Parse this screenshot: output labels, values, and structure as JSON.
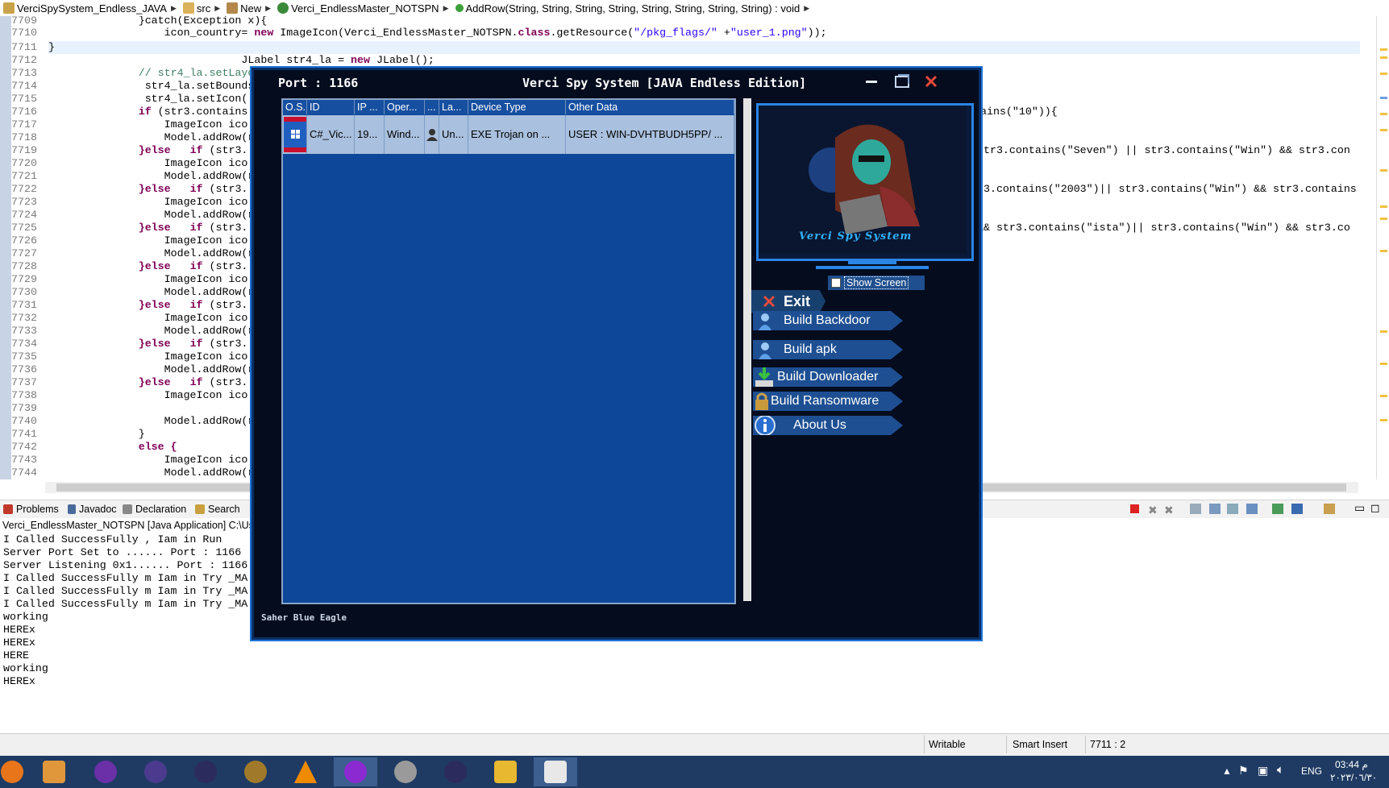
{
  "breadcrumb": [
    "VerciSpySystem_Endless_JAVA",
    "src",
    "New",
    "Verci_EndlessMaster_NOTSPN",
    "AddRow(String, String, String, String, String, String, String, String) : void"
  ],
  "code": {
    "line_numbers": [
      "7709",
      "7710",
      "7711",
      "7712",
      "7713",
      "7714",
      "7715",
      "7716",
      "7717",
      "7718",
      "7719",
      "7720",
      "7721",
      "7722",
      "7723",
      "7724",
      "7725",
      "7726",
      "7727",
      "7728",
      "7729",
      "7730",
      "7731",
      "7732",
      "7733",
      "7734",
      "7735",
      "7736",
      "7737",
      "7738",
      "7739",
      "7740",
      "7741",
      "7742",
      "7743",
      "7744"
    ],
    "line_7709": "}catch(Exception x){",
    "line_7710_pre": "icon_country= ",
    "line_7710_kw": "new",
    "line_7710_mid": " ImageIcon(Verci_EndlessMaster_NOTSPN.",
    "line_7710_kw2": "class",
    "line_7710_call": ".getResource(",
    "line_7710_s1": "\"/pkg_flags/\"",
    "line_7710_plus": " +",
    "line_7710_s2": "\"user_1.png\"",
    "line_7710_end": "));",
    "line_7711": "}",
    "line_7712_pre": "JLabel str4_la = ",
    "line_7712_kw": "new",
    "line_7712_post": " JLabel();",
    "line_7713": "// str4_la.setLayout",
    "line_7714": "str4_la.setBounds",
    "line_7715": "str4_la.setIcon(",
    "if": "if",
    "else": "}else",
    "str3": " (str3.contains",
    "str3s": " (str3.",
    "imageicon": "ImageIcon ico",
    "addrow": "Model.addRow(",
    "addrow_cut": "Model.addRow(r",
    "close_brace": "}",
    "else_open": "else {",
    "right_7716": "ains(\"10\")){",
    "right_7719": "str3.contains(\"Seven\") || str3.contains(\"Win\") && str3.con",
    "right_7722": "r3.contains(\"2003\")|| str3.contains(\"Win\") && str3.contains",
    "right_7725": "&& str3.contains(\"ista\")|| str3.contains(\"Win\") && str3.co"
  },
  "bottom_tabs": [
    "Problems",
    "Javadoc",
    "Declaration",
    "Search"
  ],
  "console_header": "Verci_EndlessMaster_NOTSPN [Java Application] C:\\Users\\",
  "console_lines": [
    "I Called SuccessFully , Iam in Run",
    "Server Port Set to ...... Port : 1166",
    "Server Listening 0x1...... Port : 1166",
    "I Called SuccessFully m Iam in Try _MA",
    "I Called SuccessFully m Iam in Try _MA",
    "I Called SuccessFully m Iam in Try _MA",
    "working",
    "HEREx",
    "HEREx",
    "HERE",
    "working",
    "HEREx"
  ],
  "status": {
    "writable": "Writable",
    "insert": "Smart Insert",
    "position": "7711 : 2"
  },
  "app": {
    "port_label": "Port : 1166",
    "title": "Verci Spy System [JAVA Endless Edition]",
    "columns": [
      "O.S.",
      "ID",
      "IP ...",
      "Oper...",
      "...",
      "La...",
      "Device Type",
      "Other Data"
    ],
    "rows": [
      {
        "id": "C#_Vic...",
        "ip": "19...",
        "os": "Wind...",
        "la": "Un...",
        "device": "EXE Trojan on ...",
        "other": "USER : WIN-DVHTBUDH5PP/ ..."
      }
    ],
    "monitor_caption": "Verci Spy System",
    "show_screen": "Show Screen",
    "exit": "Exit",
    "menu": [
      "Build Backdoor",
      "Build apk",
      "Build Downloader",
      "Build Ransomware",
      "About Us"
    ],
    "footer": "Saher Blue Eagle"
  },
  "taskbar": {
    "lang": "ENG",
    "time": "03:44 م",
    "date": "٢٠٢٣/٠٦/٣٠"
  },
  "colors": {
    "app_bg": "#040c1e",
    "app_border": "#1e74d8",
    "table_bg": "#0d4799",
    "row_selected": "#a9c0de",
    "menu_btn": "#1e4f92"
  }
}
